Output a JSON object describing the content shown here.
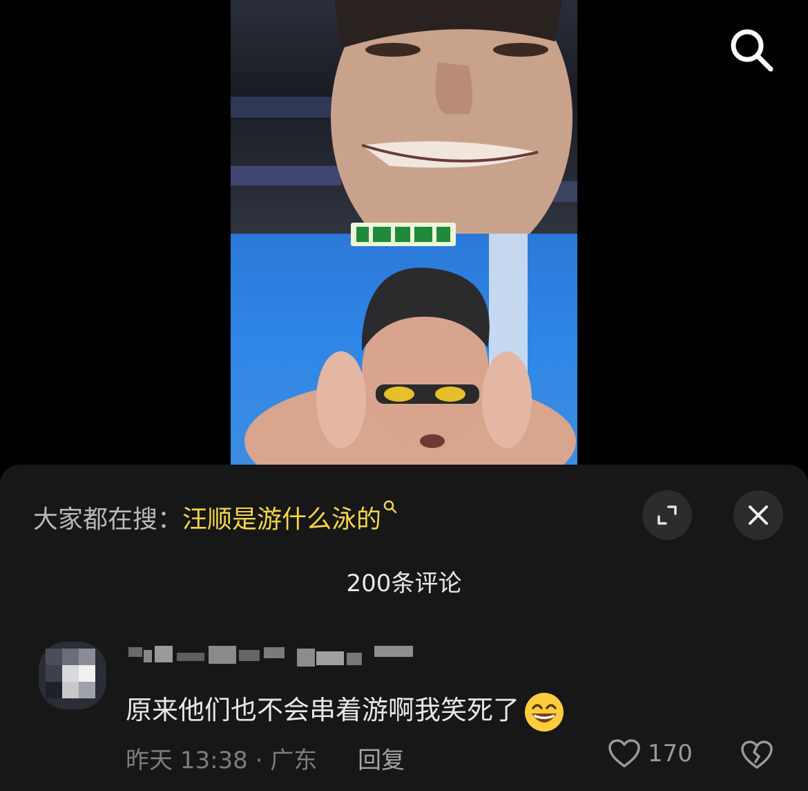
{
  "video": {
    "caption_icon": "subtitle-strip"
  },
  "top_bar": {
    "search_icon": "search-icon"
  },
  "trending_search": {
    "prefix": "大家都在搜：",
    "query": "汪顺是游什么泳的"
  },
  "comments_header": {
    "count_label": "200条评论"
  },
  "comment": {
    "text": "原来他们也不会串着游啊我笑死了",
    "emoji": "grinning-face-emoji",
    "meta": "昨天 13:38 · 广东",
    "reply_label": "回复",
    "like_count": "170"
  },
  "icons": {
    "expand": "expand-icon",
    "close": "close-icon",
    "like": "heart-icon",
    "dislike": "broken-heart-icon"
  },
  "colors": {
    "accent": "#f6d64a",
    "sheet_bg": "#171717"
  }
}
